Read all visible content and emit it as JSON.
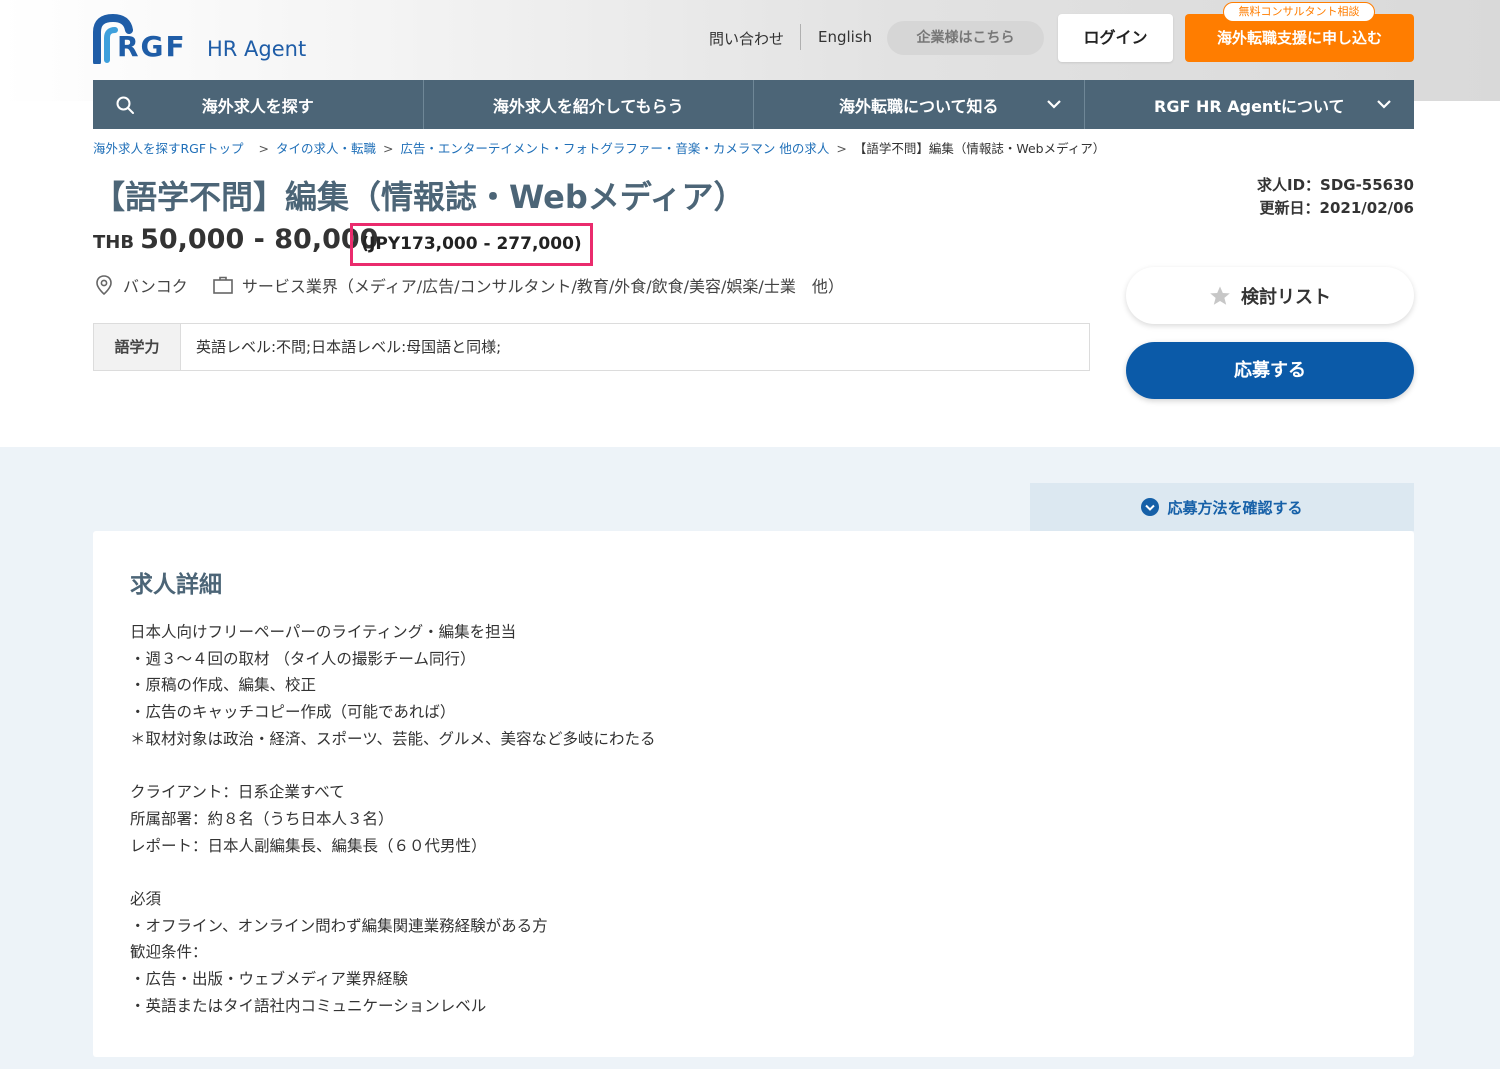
{
  "header": {
    "logo_mark": "RGF",
    "logo_sub": "HR Agent",
    "contact": "問い合わせ",
    "english": "English",
    "corporate": "企業様はこちら",
    "login": "ログイン",
    "apply_support": "海外転職支援に申し込む",
    "free_badge": "無料コンサルタント相談",
    "accent_color": "#ff7d00"
  },
  "nav": {
    "items": [
      {
        "label": "海外求人を探す",
        "icon": "search-icon"
      },
      {
        "label": "海外求人を紹介してもらう"
      },
      {
        "label": "海外転職について知る",
        "icon": "chevron-down-icon"
      },
      {
        "label": "RGF HR Agentについて",
        "icon": "chevron-down-icon"
      }
    ]
  },
  "breadcrumb": {
    "items": [
      "海外求人を探すRGFトップ",
      "タイの求人・転職",
      "広告・エンターテイメント・フォトグラファー・音楽・カメラマン 他の求人",
      "【語学不問】編集（情報誌・Webメディア）"
    ]
  },
  "job": {
    "title": "【語学不問】編集（情報誌・Webメディア）",
    "id": "求人ID：SDG-55630",
    "updated": "更新日：2021/02/06",
    "currency": "THB",
    "salary": "50,000 - 80,000",
    "salary_jpy": "(JPY173,000 - 277,000)",
    "location": "バンコク",
    "industry": "サービス業界（メディア/広告/コンサルタント/教育/外食/飲食/美容/娯楽/士業　他）",
    "lang_label": "語学力",
    "lang_value": "英語レベル:不問;日本語レベル:母国語と同様;"
  },
  "actions": {
    "favorite": "検討リスト",
    "apply": "応募する",
    "how_to": "応募方法を確認する"
  },
  "detail": {
    "title": "求人詳細",
    "body": "日本人向けフリーペーパーのライティング・編集を担当\n・週３～４回の取材 （タイ人の撮影チーム同行）\n・原稿の作成、編集、校正\n・広告のキャッチコピー作成（可能であれば）\n＊取材対象は政治・経済、スポーツ、芸能、グルメ、美容など多岐にわたる\n\nクライアント：日系企業すべて\n所属部署：約８名（うち日本人３名）\nレポート：日本人副編集長、編集長（６０代男性）\n\n必須\n・オフライン、オンライン問わず編集関連業務経験がある方\n歓迎条件：\n・広告・出版・ウェブメディア業界経験\n・英語またはタイ語社内コミュニケーションレベル"
  }
}
